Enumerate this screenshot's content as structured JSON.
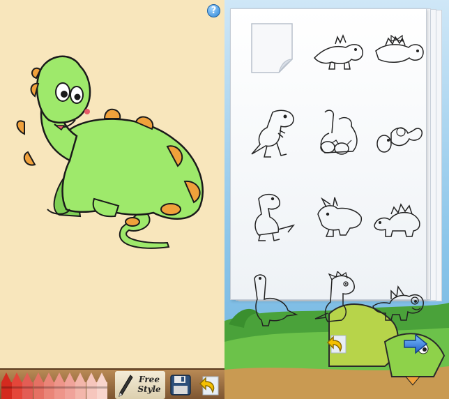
{
  "canvas": {
    "background": "#f8e6bc",
    "dino_fill": "#9ee96b",
    "plate_fill": "#f0a13b",
    "help_icon": "?"
  },
  "toolbar": {
    "crayon_colors": [
      "#d42a1f",
      "#e4463a",
      "#e35d55",
      "#e57164",
      "#ea8578",
      "#ee958a",
      "#f0a39a",
      "#f3b6ab",
      "#f6c6bd",
      "#f8d5cd"
    ],
    "freestyle_label": "Free\nStyle",
    "save_icon": "floppy-disk-icon",
    "undo_icon": "undo-arrow-icon"
  },
  "gallery": {
    "thumbnails": [
      "blank-page",
      "triceratops-baby",
      "stegosaurus-bow",
      "trex-running",
      "dino-family",
      "dino-eggs",
      "trex-standing",
      "triceratops",
      "stegosaurus",
      "brontosaurus",
      "trex-spiky",
      "stegosaurus-smiling"
    ],
    "undo_icon": "undo-arrow-icon",
    "next_icon": "next-arrow-icon"
  }
}
